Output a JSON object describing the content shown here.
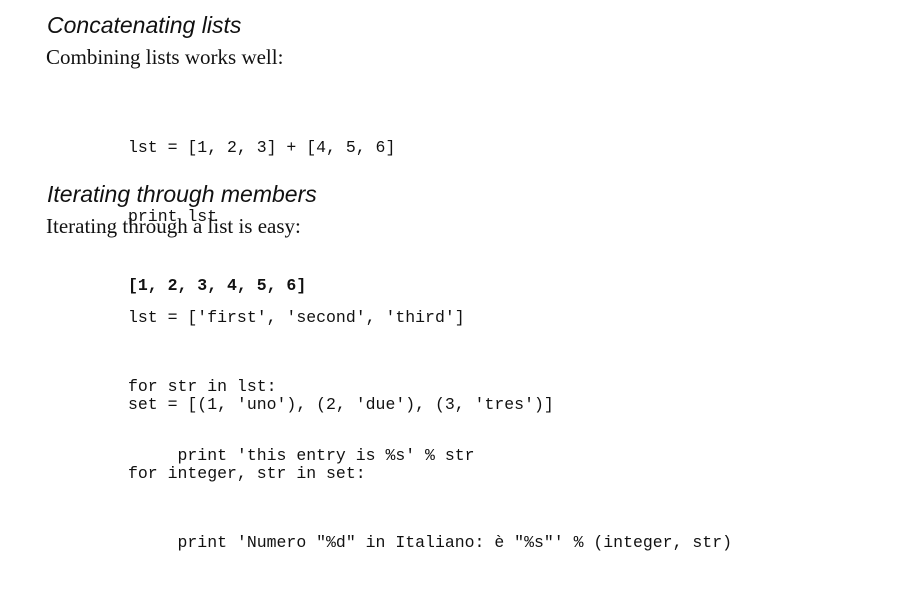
{
  "sections": [
    {
      "heading": "Concatenating lists",
      "paragraph": "Combining lists works well:",
      "code_lines": [
        "lst = [1, 2, 3] + [4, 5, 6]",
        "print lst"
      ],
      "output_line": "[1, 2, 3, 4, 5, 6]"
    },
    {
      "heading": "Iterating through members",
      "paragraph": "Iterating through a list is easy:",
      "code_block_1": [
        "lst = ['first', 'second', 'third']",
        "for str in lst:",
        "     print 'this entry is %s' % str"
      ],
      "code_block_2": [
        "set = [(1, 'uno'), (2, 'due'), (3, 'tres')]",
        "for integer, str in set:",
        "     print 'Numero \"%d\" in Italiano: è \"%s\"' % (integer, str)"
      ]
    }
  ]
}
